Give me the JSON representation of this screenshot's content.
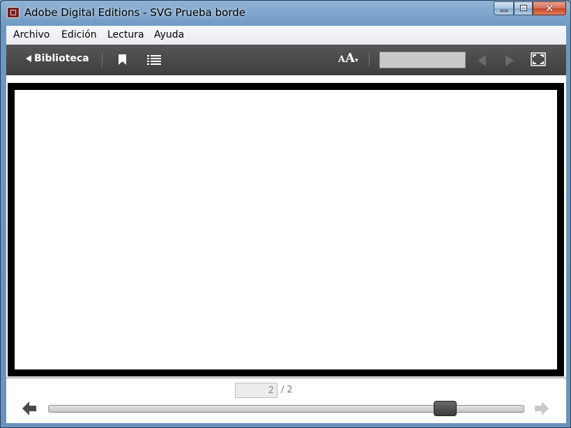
{
  "window": {
    "title": "Adobe Digital Editions - SVG Prueba borde"
  },
  "menu": {
    "items": [
      "Archivo",
      "Edición",
      "Lectura",
      "Ayuda"
    ]
  },
  "toolbar": {
    "library_label": "Biblioteca",
    "font_size_icon": "font-size-icon",
    "search": {
      "value": "",
      "placeholder": ""
    }
  },
  "footer": {
    "page_input": "2",
    "page_total": "/ 2",
    "slider_level": 0.85
  },
  "colors": {
    "toolbar_bg": "#4a4a4a",
    "page_border": "#000000",
    "titlebar": "#8fb3d6"
  }
}
